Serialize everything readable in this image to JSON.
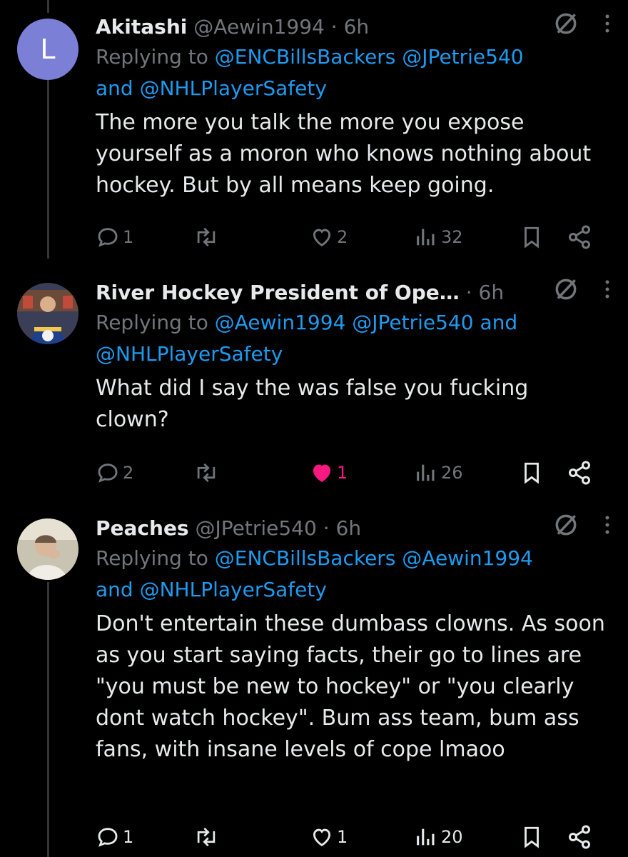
{
  "tweets": [
    {
      "avatar_letter": "L",
      "name": "Akitashi",
      "handle": "@Aewin1994",
      "sep": "·",
      "time": "6h",
      "replying_prefix": "Replying to",
      "mentions_line1": "@ENCBillsBackers @JPetrie540",
      "and_word": "and",
      "mentions_line2": "@NHLPlayerSafety",
      "text": "The more you talk the more you expose yourself as a moron who knows nothing about hockey. But by all means keep going.",
      "replies": "1",
      "likes": "2",
      "views": "32",
      "liked": false
    },
    {
      "name": "River Hockey President of Ope…",
      "sep": "·",
      "time": "6h",
      "replying_prefix": "Replying to",
      "mentions_line1": "@Aewin1994 @JPetrie540",
      "and_word": "and",
      "mentions_line2": "@NHLPlayerSafety",
      "text": "What did I say the was false you fucking clown?",
      "replies": "2",
      "likes": "1",
      "views": "26",
      "liked": true
    },
    {
      "name": "Peaches",
      "handle": "@JPetrie540",
      "sep": "·",
      "time": "6h",
      "replying_prefix": "Replying to",
      "mentions_line1": "@ENCBillsBackers @Aewin1994",
      "and_word": "and",
      "mentions_line2": "@NHLPlayerSafety",
      "text": "Don't entertain these dumbass clowns. As soon as you start saying facts, their go to lines are \"you must be new to hockey\" or \"you clearly dont watch hockey\". Bum ass team, bum ass fans, with insane levels of cope lmaoo",
      "replies": "1",
      "likes": "1",
      "views": "20",
      "liked": false
    }
  ],
  "colors": {
    "background": "#000000",
    "text": "#e7e9ea",
    "muted": "#71767b",
    "link": "#1d9bf0",
    "like": "#f91880"
  },
  "icons": [
    "grok-icon",
    "more-icon",
    "reply-icon",
    "retweet-icon",
    "heart-icon",
    "views-icon",
    "bookmark-icon",
    "share-icon"
  ]
}
